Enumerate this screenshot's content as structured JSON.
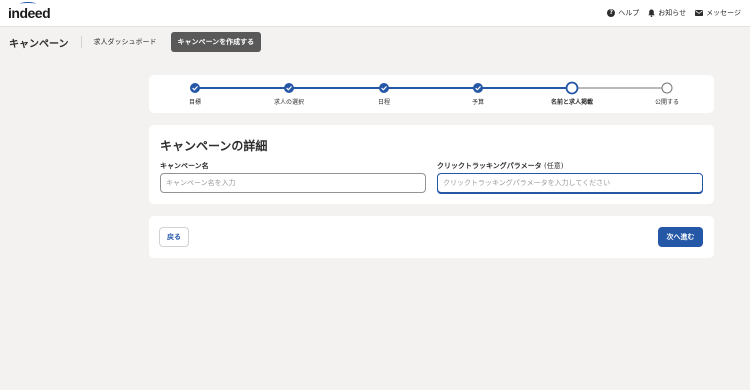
{
  "header": {
    "logo_text": "indeed",
    "links": [
      {
        "label": "ヘルプ",
        "icon": "help-icon"
      },
      {
        "label": "お知らせ",
        "icon": "bell-icon"
      },
      {
        "label": "メッセージ",
        "icon": "mail-icon"
      }
    ]
  },
  "subheader": {
    "title": "キャンペーン",
    "dashboard_link": "求人ダッシュボード",
    "create_button": "キャンペーンを作成する"
  },
  "stepper": {
    "steps": [
      {
        "label": "目標",
        "state": "completed"
      },
      {
        "label": "求人の選択",
        "state": "completed"
      },
      {
        "label": "日程",
        "state": "completed"
      },
      {
        "label": "予算",
        "state": "completed"
      },
      {
        "label": "名前と求人掲載",
        "state": "current"
      },
      {
        "label": "公開する",
        "state": "upcoming"
      }
    ]
  },
  "details": {
    "title": "キャンペーンの詳細",
    "name_label": "キャンペーン名",
    "name_placeholder": "キャンペーン名を入力",
    "name_value": "",
    "tracking_label": "クリックトラッキングパラメータ",
    "tracking_optional": "(任意)",
    "tracking_placeholder": "クリックトラッキングパラメータを入力してください",
    "tracking_value": ""
  },
  "navigation": {
    "back_label": "戻る",
    "next_label": "次へ進む"
  },
  "colors": {
    "accent": "#2557a7",
    "background": "#f3f2f1",
    "create_button_bg": "#595959"
  }
}
